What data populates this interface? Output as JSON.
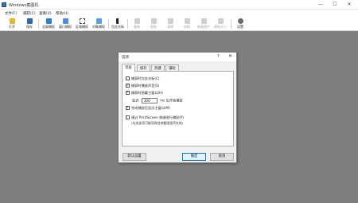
{
  "window": {
    "title": "Windows截图机"
  },
  "menubar": {
    "items": [
      "文件(F)",
      "捕获(C)",
      "查看(V)",
      "帮助(H)"
    ]
  },
  "toolbar": {
    "open": "打开",
    "save": "保存",
    "fullscreen": "全屏捕捉",
    "window_capture": "窗口捕捉",
    "region_capture": "区域捕捉",
    "object_capture": "对象捕捉",
    "include_cursor": "包含光标",
    "copy": "复制",
    "paste": "粘贴",
    "clear": "清除",
    "trim": "修剪",
    "restore_image": "恢复图片",
    "actual_size": "原始大小",
    "settings": "设置"
  },
  "dialog": {
    "title": "选项",
    "help": "?",
    "close": "✕",
    "tabs": [
      "常规",
      "保存",
      "热键",
      "辅助"
    ],
    "active_tab": 0,
    "options": {
      "include_cursor": {
        "label": "捕获时包含光标(C)",
        "checked": false
      },
      "play_sound": {
        "label": "捕获时播放声音(S)",
        "checked": true
      },
      "hide_window": {
        "label": "捕获时隐藏主窗口(H)",
        "checked": true
      },
      "delay_prefix": "延迟",
      "delay_value": "300",
      "delay_suffix": "ms 后开始捕捉",
      "show_after": {
        "label": "完成捕捉后显示主窗口(M)",
        "checked": true
      },
      "printscreen": {
        "label": "通过 PrintScreen 按键进行捕捉(P)",
        "checked": false
      },
      "printscreen_note": "(勾选该项可能导致其他截图程序失效)"
    },
    "buttons": {
      "defaults": "默认设置",
      "ok": "确定",
      "cancel": "取消"
    }
  },
  "colors": {
    "workspace": "#7f7f7f",
    "accent": "#0078d7"
  }
}
